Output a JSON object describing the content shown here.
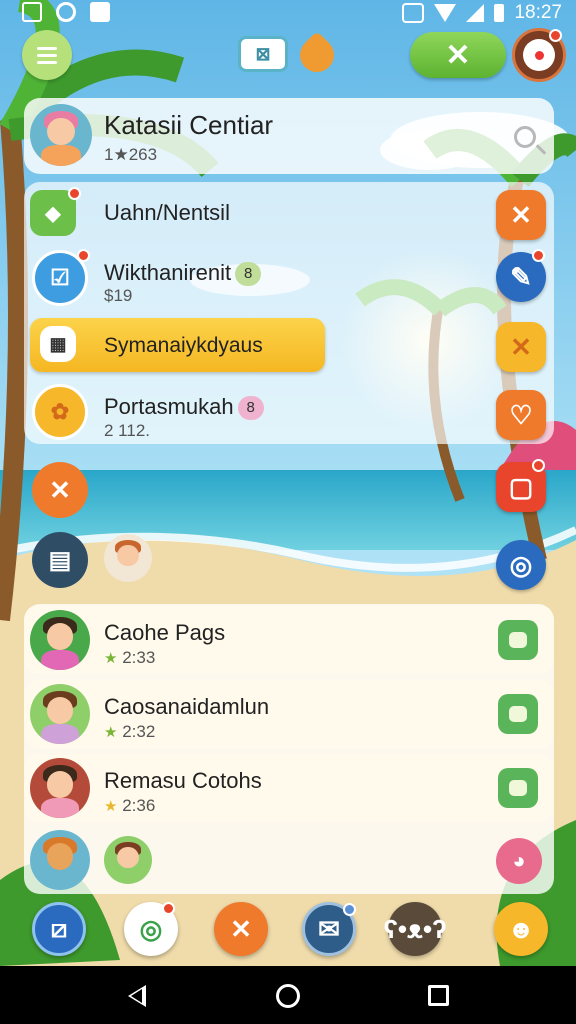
{
  "status_bar": {
    "time": "18:27"
  },
  "header": {
    "game_icon_text": "⊠",
    "action_button_text": "✕"
  },
  "profile": {
    "name": "Katasii Centiar",
    "score": "1★263"
  },
  "list": {
    "items": [
      {
        "label": "Uahn/Nentsil",
        "sub": ""
      },
      {
        "label": "Wikthanirenit",
        "badge": "8",
        "sub": "$19"
      },
      {
        "label": "Symanaiykdyaus",
        "sub": ""
      },
      {
        "label": "Portasmukah",
        "badge": "8",
        "sub": "2 1​12."
      }
    ]
  },
  "chats": [
    {
      "name": "Caohe Pags",
      "time": "2:33",
      "star": "★"
    },
    {
      "name": "Caosanaidamlun",
      "time": "2:32",
      "star": "★"
    },
    {
      "name": "Remasu Cotohs",
      "time": "2:36",
      "star": "★"
    }
  ],
  "icons": {
    "menu": "menu-icon",
    "search": "search-icon",
    "close": "close-icon",
    "edit": "pencil-icon",
    "heart": "heart-icon",
    "mail": "mail-icon"
  },
  "colors": {
    "accent_green": "#5db331",
    "accent_orange": "#ef7b2a",
    "highlight_yellow": "#f5b722",
    "accent_blue": "#2a6bbf"
  }
}
